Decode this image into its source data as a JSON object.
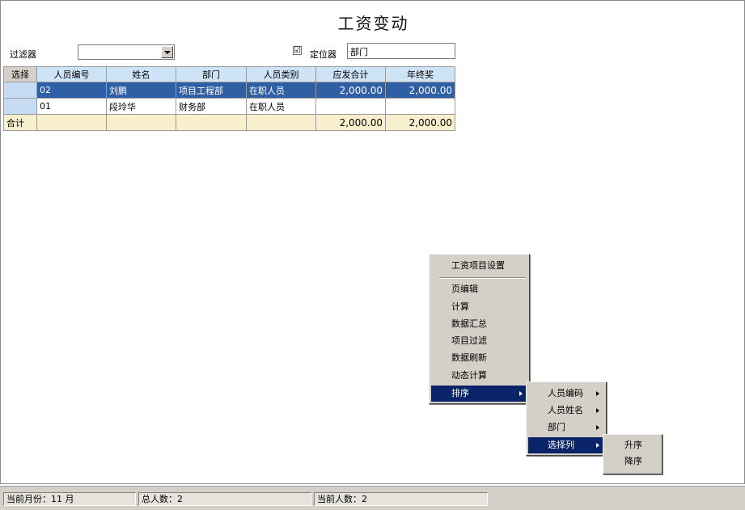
{
  "window": {
    "title": "工资变动"
  },
  "toolbar": {
    "filter_label": "过滤器",
    "filter_value": "",
    "locator_check": "☑",
    "locator_label": "定位器",
    "locator_value": "部门"
  },
  "grid": {
    "columns": [
      "选择",
      "人员编号",
      "姓名",
      "部门",
      "人员类别",
      "应发合计",
      "年终奖"
    ],
    "rows": [
      {
        "id": "02",
        "name": "刘鹏",
        "dept": "项目工程部",
        "category": "在职人员",
        "gross": "2,000.00",
        "bonus": "2,000.00"
      },
      {
        "id": "01",
        "name": "段玲华",
        "dept": "财务部",
        "category": "在职人员",
        "gross": "",
        "bonus": ""
      }
    ],
    "total": {
      "label": "合计",
      "gross": "2,000.00",
      "bonus": "2,000.00"
    }
  },
  "context_menu": {
    "items": [
      "工资项目设置",
      "页编辑",
      "计算",
      "数据汇总",
      "项目过滤",
      "数据刷新",
      "动态计算",
      "排序"
    ]
  },
  "sort_submenu": {
    "items": [
      "人员编码",
      "人员姓名",
      "部门",
      "选择列"
    ]
  },
  "order_submenu": {
    "items": [
      "升序",
      "降序"
    ]
  },
  "status": {
    "current_month": "当前月份：11 月",
    "total_people": "总人数：2",
    "current_people": "当前人数：2"
  },
  "colors": {
    "header_bg": "#cfe3f6",
    "selected_row": "#2f5fa5",
    "total_row": "#f8f0cc",
    "menu_highlight": "#0a246a"
  }
}
